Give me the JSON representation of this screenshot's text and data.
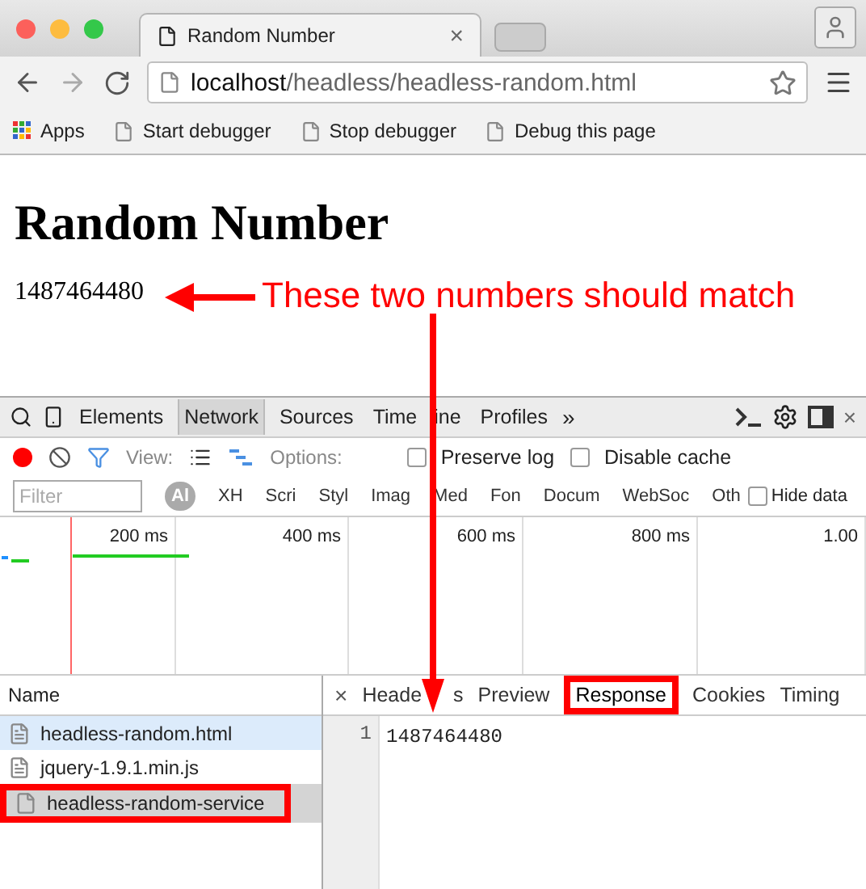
{
  "browser": {
    "tab": {
      "title": "Random Number",
      "close": "×"
    },
    "url": {
      "host": "localhost",
      "path": "/headless/headless-random.html"
    },
    "bookmarks": [
      {
        "label": "Apps",
        "kind": "apps"
      },
      {
        "label": "Start debugger",
        "kind": "page"
      },
      {
        "label": "Stop debugger",
        "kind": "page"
      },
      {
        "label": "Debug this page",
        "kind": "page"
      }
    ]
  },
  "page": {
    "heading": "Random Number",
    "number": "1487464480"
  },
  "annotation": {
    "text": "These two numbers should match"
  },
  "devtools": {
    "panels": [
      {
        "label": "Elements",
        "selected": false
      },
      {
        "label": "Network",
        "selected": true
      },
      {
        "label": "Sources",
        "selected": false
      },
      {
        "label": "Time ine",
        "selected": false
      },
      {
        "label": "Profiles",
        "selected": false
      }
    ],
    "more": "»",
    "close": "×",
    "recording": true,
    "view_label": "View:",
    "options_label": "Options:",
    "checkboxes": [
      {
        "label": "Preserve log",
        "checked": false
      },
      {
        "label": "Disable cache",
        "checked": false
      }
    ],
    "filter_placeholder": "Filter",
    "types": [
      {
        "label": "Al",
        "selected": true
      },
      {
        "label": "XH",
        "selected": false
      },
      {
        "label": "Scri",
        "selected": false
      },
      {
        "label": "Styl",
        "selected": false
      },
      {
        "label": "Imag",
        "selected": false
      },
      {
        "label": "Med",
        "selected": false
      },
      {
        "label": "Fon",
        "selected": false
      },
      {
        "label": "Docum",
        "selected": false
      },
      {
        "label": "WebSoc",
        "selected": false
      },
      {
        "label": "Oth",
        "selected": false
      }
    ],
    "hide_data": {
      "label": "Hide data",
      "checked": false
    },
    "ticks": [
      "200 ms",
      "400 ms",
      "600 ms",
      "800 ms",
      "1.00"
    ],
    "name_header": "Name",
    "requests": [
      {
        "name": "headless-random.html",
        "kind": "document",
        "selected": false,
        "hovered": true,
        "boxed": false
      },
      {
        "name": "jquery-1.9.1.min.js",
        "kind": "document",
        "selected": false,
        "hovered": false,
        "boxed": false
      },
      {
        "name": "headless-random-service",
        "kind": "blank",
        "selected": true,
        "hovered": false,
        "boxed": true
      }
    ],
    "detail_close": "×",
    "detail_tabs": [
      {
        "label": "Heade s",
        "selected": false,
        "boxed": false
      },
      {
        "label": "Preview",
        "selected": false,
        "boxed": false
      },
      {
        "label": "Response",
        "selected": true,
        "boxed": true
      },
      {
        "label": "Cookies",
        "selected": false,
        "boxed": false
      },
      {
        "label": "Timing",
        "selected": false,
        "boxed": false
      }
    ],
    "response": {
      "line": "1",
      "text": "1487464480"
    }
  }
}
